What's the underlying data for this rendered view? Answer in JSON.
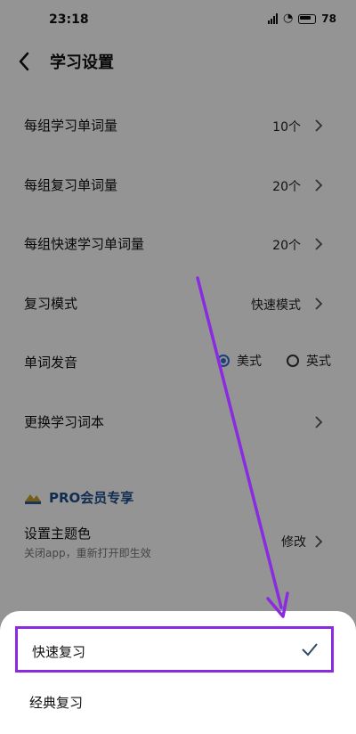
{
  "status_bar": {
    "time": "23:18",
    "battery": "78"
  },
  "header": {
    "title": "学习设置"
  },
  "settings": [
    {
      "label": "每组学习单词量",
      "value": "10个"
    },
    {
      "label": "每组复习单词量",
      "value": "20个"
    },
    {
      "label": "每组快速学习单词量",
      "value": "20个"
    },
    {
      "label": "复习模式",
      "value": "快速模式"
    }
  ],
  "pronunciation": {
    "label": "单词发音",
    "options": [
      "美式",
      "英式"
    ],
    "selected": "美式"
  },
  "change_book": {
    "label": "更换学习词本"
  },
  "pro": {
    "section_label": "PRO会员专享",
    "theme": {
      "label": "设置主题色",
      "sublabel": "关闭app，重新打开即生效",
      "value": "修改"
    }
  },
  "sheet": {
    "options": [
      {
        "label": "快速复习",
        "selected": true
      },
      {
        "label": "经典复习",
        "selected": false
      }
    ]
  },
  "colors": {
    "accent": "#2f6fd6",
    "annotation": "#8a2be2",
    "pro_text": "#1d4e8c"
  }
}
